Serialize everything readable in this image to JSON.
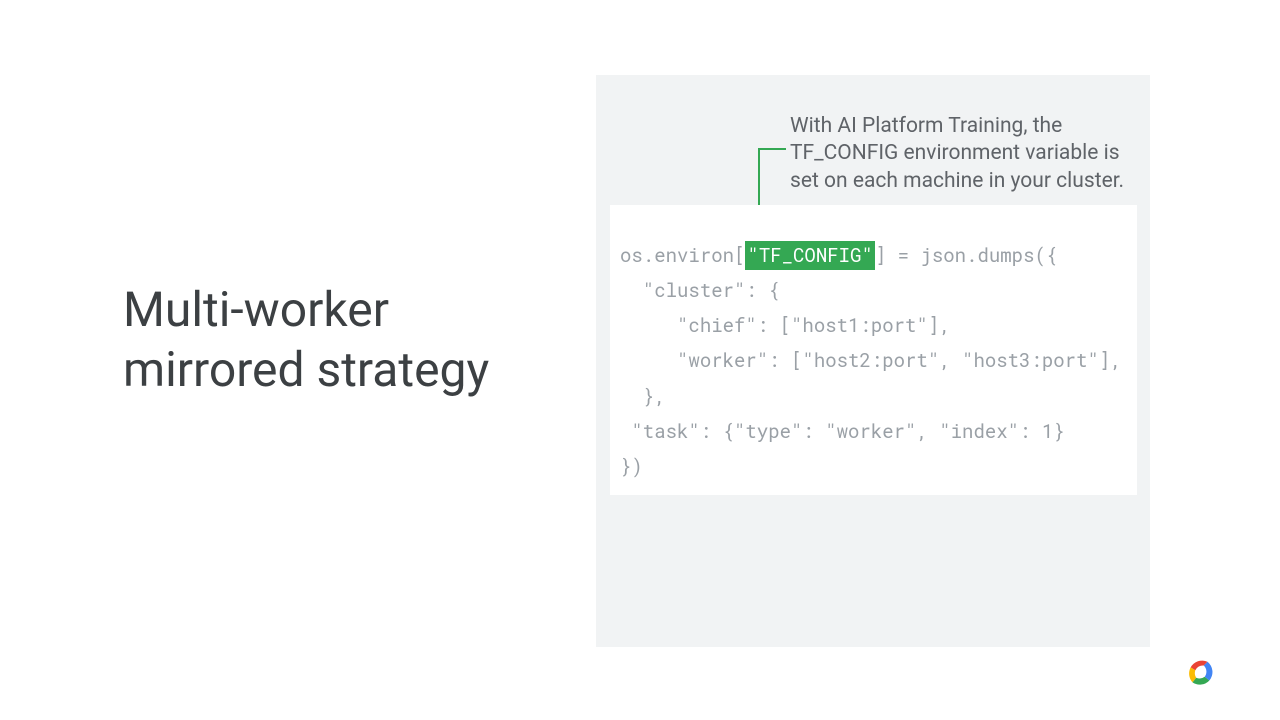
{
  "title_line1": "Multi-worker",
  "title_line2": "mirrored strategy",
  "annotation": "With AI Platform Training, the TF_CONFIG environment variable is set on each machine in your cluster.",
  "highlight_text": "\"TF_CONFIG\"",
  "code": {
    "line1_pre": "os.environ[",
    "line1_post": "] = json.dumps({",
    "line2": "  \"cluster\": {",
    "line3": "     \"chief\": [\"host1:port\"],",
    "line4": "     \"worker\": [\"host2:port\", \"host3:port\"],",
    "line5": "  },",
    "line6": " \"task\": {\"type\": \"worker\", \"index\": 1}",
    "line7": "})"
  }
}
